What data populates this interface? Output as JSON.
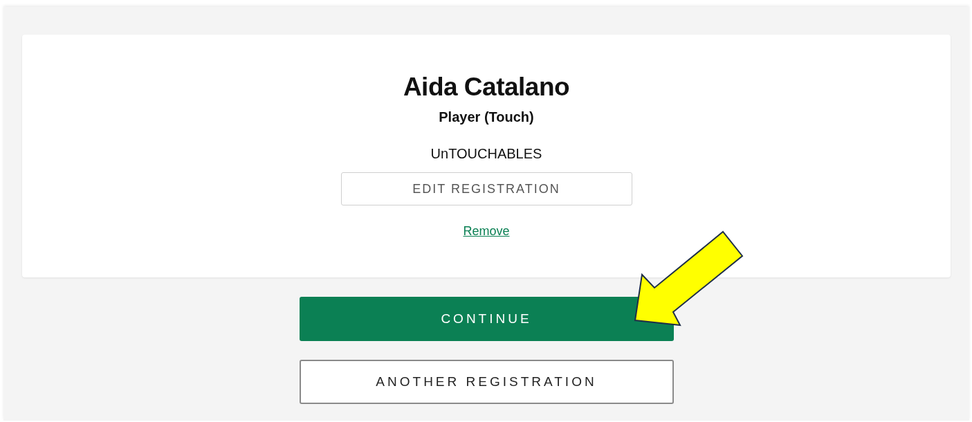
{
  "registration": {
    "name": "Aida Catalano",
    "role": "Player (Touch)",
    "team": "UnTOUCHABLES",
    "edit_button": "EDIT REGISTRATION",
    "remove_link": "Remove"
  },
  "continue_button": "CONTINUE",
  "another_button": "ANOTHER REGISTRATION"
}
